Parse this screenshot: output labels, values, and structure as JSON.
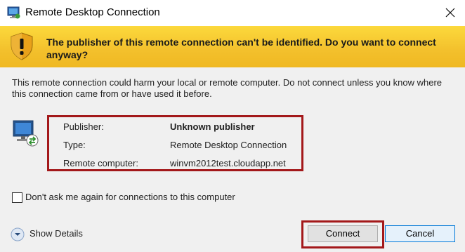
{
  "window": {
    "title": "Remote Desktop Connection",
    "icon": "remote-desktop-icon",
    "close_icon": "close-icon"
  },
  "warning": {
    "icon": "shield-warning-icon",
    "heading": "The publisher of this remote connection can't be identified. Do you want to connect anyway?",
    "background_color": "#f5c42e"
  },
  "description": "This remote connection could harm your local or remote computer. Do not connect unless you know where this connection came from or have used it before.",
  "connection_info": {
    "icon": "monitor-icon",
    "rows": [
      {
        "label": "Publisher:",
        "value": "Unknown publisher",
        "bold": true
      },
      {
        "label": "Type:",
        "value": "Remote Desktop Connection",
        "bold": false
      },
      {
        "label": "Remote computer:",
        "value": "winvm2012test.cloudapp.net",
        "bold": false
      }
    ],
    "highlight_color": "#a3181a"
  },
  "dont_ask_checkbox": {
    "label": "Don't ask me again for connections to this computer",
    "checked": false
  },
  "details": {
    "label": "Show Details",
    "icon": "chevron-down-icon"
  },
  "buttons": {
    "connect": "Connect",
    "cancel": "Cancel"
  }
}
